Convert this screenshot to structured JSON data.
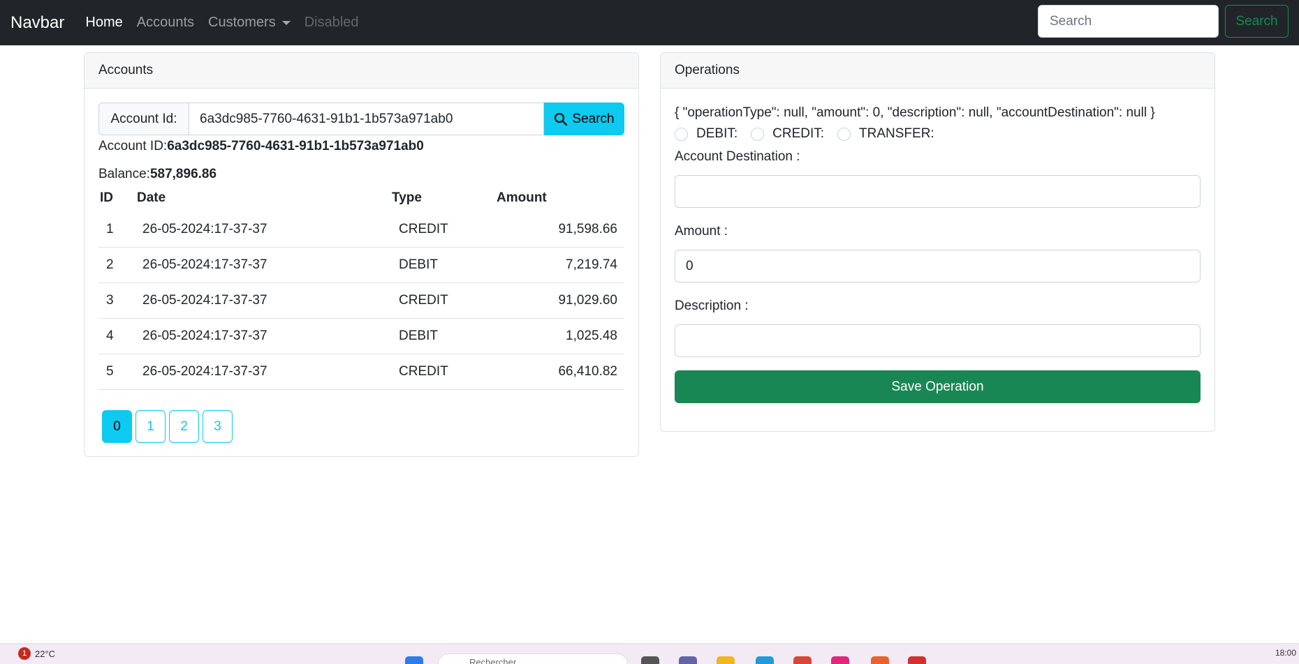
{
  "navbar": {
    "brand": "Navbar",
    "links": {
      "home": "Home",
      "accounts": "Accounts",
      "customers": "Customers",
      "disabled": "Disabled"
    },
    "search_placeholder": "Search",
    "search_button": "Search"
  },
  "accounts_card": {
    "title": "Accounts",
    "search_label": "Account Id:",
    "search_value": "6a3dc985-7760-4631-91b1-1b573a971ab0",
    "search_button": "Search",
    "account_id_label": "Account ID:",
    "account_id_value": "6a3dc985-7760-4631-91b1-1b573a971ab0",
    "balance_label": "Balance:",
    "balance_value": "587,896.86",
    "table": {
      "headers": {
        "id": "ID",
        "date": "Date",
        "type": "Type",
        "amount": "Amount"
      },
      "rows": [
        {
          "id": "1",
          "date": "26-05-2024:17-37-37",
          "type": "CREDIT",
          "amount": "91,598.66"
        },
        {
          "id": "2",
          "date": "26-05-2024:17-37-37",
          "type": "DEBIT",
          "amount": "7,219.74"
        },
        {
          "id": "3",
          "date": "26-05-2024:17-37-37",
          "type": "CREDIT",
          "amount": "91,029.60"
        },
        {
          "id": "4",
          "date": "26-05-2024:17-37-37",
          "type": "DEBIT",
          "amount": "1,025.48"
        },
        {
          "id": "5",
          "date": "26-05-2024:17-37-37",
          "type": "CREDIT",
          "amount": "66,410.82"
        }
      ]
    },
    "pages": [
      "0",
      "1",
      "2",
      "3"
    ],
    "active_page": "0"
  },
  "operations_card": {
    "title": "Operations",
    "form_json": "{ \"operationType\": null, \"amount\": 0, \"description\": null, \"accountDestination\": null }",
    "radio_options": {
      "debit": "DEBIT:",
      "credit": "CREDIT:",
      "transfer": "TRANSFER:"
    },
    "account_destination_label": "Account Destination :",
    "account_destination_value": "",
    "amount_label": "Amount :",
    "amount_value": "0",
    "description_label": "Description :",
    "description_value": "",
    "save_button": "Save Operation"
  },
  "taskbar": {
    "weather_badge": "1",
    "temperature": "22°C",
    "search_text": "Rechercher",
    "time": "18:00"
  },
  "colors": {
    "navbar_bg": "#212529",
    "info": "#0dcaf0",
    "success": "#198754"
  }
}
